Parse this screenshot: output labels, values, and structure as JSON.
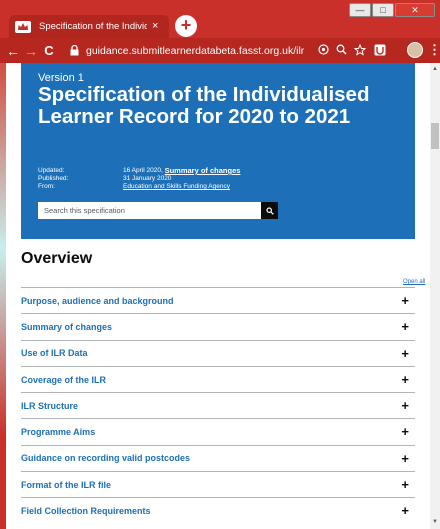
{
  "browser": {
    "tab_title": "Specification of the Individualise",
    "tab_close": "×",
    "new_tab": "+",
    "url": "guidance.submitlearnerdatabeta.fasst.org.uk/ilr",
    "back": "←",
    "forward": "→",
    "reload": "C",
    "window_min": "—",
    "window_max": "□",
    "window_close": "✕",
    "menu": "⋮",
    "accent_color": "#c9302a"
  },
  "hero": {
    "version": "Version 1",
    "title": "Specification of the Individualised Learner Record for 2020 to 2021",
    "updated_label": "Updated:",
    "updated_value": "16 April 2020,",
    "updated_link": "Summary of changes",
    "published_label": "Published:",
    "published_value": "31 January 2020",
    "from_label": "From:",
    "from_value": "Education and Skills Funding Agency",
    "search_placeholder": "Search this specification",
    "background_color": "#1d70b8"
  },
  "main": {
    "heading": "Overview",
    "open_all": "Open all",
    "accordion": [
      {
        "label": "Purpose, audience and background"
      },
      {
        "label": "Summary of changes"
      },
      {
        "label": "Use of ILR Data"
      },
      {
        "label": "Coverage of the ILR"
      },
      {
        "label": "ILR Structure"
      },
      {
        "label": "Programme Aims"
      },
      {
        "label": "Guidance on recording valid postcodes"
      },
      {
        "label": "Format of the ILR file"
      },
      {
        "label": "Field Collection Requirements"
      }
    ],
    "expand_symbol": "+"
  }
}
